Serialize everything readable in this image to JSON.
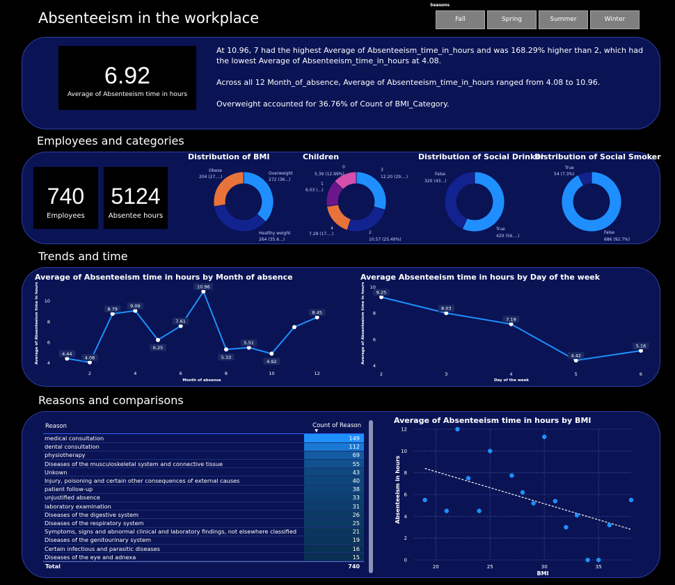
{
  "page_title": "Absenteeism in the workplace",
  "seasons": {
    "label": "Seasons",
    "options": [
      "Fall",
      "Spring",
      "Summer",
      "Winter"
    ]
  },
  "summary": {
    "kpi_value": "6.92",
    "kpi_label": "Average of Absenteeism time in hours",
    "narrative_1": "At 10.96, 7 had the highest Average of Absenteeism_time_in_hours and was 168.29% higher than 2, which had the lowest Average of Absenteeism_time_in_hours at 4.08.",
    "narrative_2": "Across all 12 Month_of_absence, Average of Absenteeism_time_in_hours ranged from 4.08 to 10.96.",
    "narrative_3": "Overweight accounted for 36.76% of Count of BMI_Category."
  },
  "sections": {
    "employees": "Employees and categories",
    "trends": "Trends and time",
    "reasons": "Reasons and comparisons"
  },
  "kpis": {
    "employees_value": "740",
    "employees_label": "Employees",
    "hours_value": "5124",
    "hours_label": "Absentee hours"
  },
  "colors": {
    "panel_bg": "#0a1354",
    "panel_border": "#2e3fa6",
    "line": "#1e90ff",
    "donut_orange": "#e8733a",
    "donut_dark_blue": "#12238f",
    "donut_light_blue": "#1f8fff",
    "donut_pink": "#d64fae",
    "donut_purple": "#6b168a"
  },
  "chart_data": [
    {
      "type": "donut",
      "title": "Distribution of BMI",
      "slices": [
        {
          "name": "Overweight",
          "value": 272,
          "label": "Overweight",
          "sub": "272 (36...)"
        },
        {
          "name": "Healthy weight",
          "value": 264,
          "label": "Healthy weight",
          "sub": "264 (35.6...)"
        },
        {
          "name": "Obese",
          "value": 204,
          "label": "Obese",
          "sub": "204 (27....)"
        }
      ]
    },
    {
      "type": "donut",
      "title": "Children",
      "slices": [
        {
          "name": "3",
          "value": 12.2,
          "label": "3",
          "sub": "12.20 (29....)"
        },
        {
          "name": "2",
          "value": 10.57,
          "label": "2",
          "sub": "10.57 (25.49%)"
        },
        {
          "name": "4",
          "value": 7.29,
          "label": "4",
          "sub": "7.29 (17....)"
        },
        {
          "name": "1",
          "value": 6.03,
          "label": "1",
          "sub": "6.03 (...)"
        },
        {
          "name": "0",
          "value": 5.39,
          "label": "0",
          "sub": "5.39 (12.99%)"
        }
      ]
    },
    {
      "type": "donut",
      "title": "Distribution of Social Drinker",
      "slices": [
        {
          "name": "True",
          "value": 420,
          "label": "True",
          "sub": "420 (56....)"
        },
        {
          "name": "False",
          "value": 320,
          "label": "False",
          "sub": "320 (43...)"
        }
      ]
    },
    {
      "type": "donut",
      "title": "Distribution of Social Smoker",
      "slices": [
        {
          "name": "False",
          "value": 686,
          "label": "False",
          "sub": "686 (92.7%)"
        },
        {
          "name": "True",
          "value": 54,
          "label": "True",
          "sub": "54 (7.3%)"
        }
      ]
    },
    {
      "type": "line",
      "title": "Average of Absenteeism time in hours by Month of absence",
      "xlabel": "Month of absense",
      "ylabel": "Average of Absenteeism time in hours",
      "x": [
        1,
        2,
        3,
        4,
        5,
        6,
        7,
        8,
        9,
        10,
        11,
        12
      ],
      "y": [
        4.44,
        4.08,
        8.79,
        9.09,
        6.25,
        7.61,
        10.96,
        5.33,
        5.51,
        4.92,
        7.5,
        8.45
      ],
      "data_labels": [
        "4.44",
        "4.08",
        "8.79",
        "9.09",
        "6.25",
        "7.61",
        "10.96",
        "5.33",
        "5.51",
        "4.92",
        "",
        "8.45"
      ],
      "xticks": [
        "2",
        "4",
        "6",
        "8",
        "10",
        "12"
      ],
      "yticks": [
        "4",
        "6",
        "8",
        "10"
      ],
      "xlim": [
        0.5,
        12.5
      ],
      "ylim": [
        3.8,
        11.3
      ]
    },
    {
      "type": "line",
      "title": "Average Absenteeism time in hours by Day of the week",
      "xlabel": "Day of the week",
      "ylabel": "Average of Absenteeism time in hours",
      "x": [
        2,
        3,
        4,
        5,
        6
      ],
      "y": [
        9.25,
        8.03,
        7.19,
        4.42,
        5.16
      ],
      "data_labels": [
        "9.25",
        "8.03",
        "7.19",
        "4.42",
        "5.16"
      ],
      "xticks": [
        "2",
        "3",
        "4",
        "5",
        "6"
      ],
      "yticks": [
        "4",
        "6",
        "8",
        "10"
      ],
      "xlim": [
        2,
        6
      ],
      "ylim": [
        4,
        10
      ]
    },
    {
      "type": "table",
      "title": "",
      "columns": [
        "Reason",
        "Count of Reason"
      ],
      "rows": [
        [
          "medical consultation",
          149
        ],
        [
          "dental consultation",
          112
        ],
        [
          "physiotherapy",
          69
        ],
        [
          "Diseases of the musculoskeletal system and connective tissue",
          55
        ],
        [
          "Unkown",
          43
        ],
        [
          "Injury, poisoning and certain other consequences of external causes",
          40
        ],
        [
          "patient follow-up",
          38
        ],
        [
          "unjustified absence",
          33
        ],
        [
          "laboratory examination",
          31
        ],
        [
          "Diseases of the digestive system",
          26
        ],
        [
          "Diseases of the respiratory system",
          25
        ],
        [
          "Symptoms, signs and abnormal clinical and laboratory findings, not elsewhere classified",
          21
        ],
        [
          "Diseases of the genitourinary system",
          19
        ],
        [
          "Certain infectious and parasitic diseases",
          16
        ],
        [
          "Diseases of the eye and adnexa",
          15
        ]
      ],
      "total_label": "Total",
      "total_value": "740"
    },
    {
      "type": "scatter",
      "title": "Average of Absenteeism time in hours by BMI",
      "xlabel": "BMI",
      "ylabel": "Absenteeism in hours",
      "points": [
        [
          19,
          5.5
        ],
        [
          21,
          4.5
        ],
        [
          22,
          12
        ],
        [
          23,
          7.5
        ],
        [
          24,
          4.5
        ],
        [
          25,
          10
        ],
        [
          27,
          7.75
        ],
        [
          28,
          6.2
        ],
        [
          29,
          5.2
        ],
        [
          30,
          11.3
        ],
        [
          31,
          5.4
        ],
        [
          32,
          3
        ],
        [
          33,
          4.1
        ],
        [
          34,
          0
        ],
        [
          35,
          0
        ],
        [
          36,
          3.2
        ],
        [
          38,
          5.5
        ]
      ],
      "trend": [
        [
          19,
          8.4
        ],
        [
          38,
          2.8
        ]
      ],
      "xticks": [
        "20",
        "25",
        "30",
        "35"
      ],
      "yticks": [
        "0",
        "2",
        "4",
        "6",
        "8",
        "10",
        "12"
      ],
      "xlim": [
        18,
        38
      ],
      "ylim": [
        0,
        12
      ]
    }
  ]
}
